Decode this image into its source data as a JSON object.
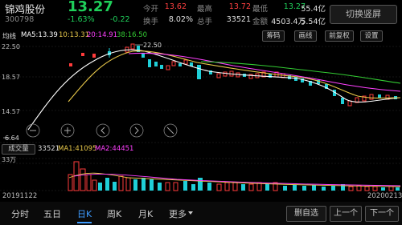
{
  "header": {
    "name": "锦鸡股份",
    "price": "13.27",
    "code": "300798",
    "change_pct": "-1.63%",
    "change_val": "-0.22",
    "quotes": [
      {
        "label": "今开",
        "value": "13.62",
        "color": "#ff4040"
      },
      {
        "label": "最高",
        "value": "13.72",
        "color": "#ff4040"
      },
      {
        "label": "最低",
        "value": "13.27",
        "color": "#1fcf5a"
      },
      {
        "label": "总值",
        "value": "55.4亿",
        "color": "#e0e0e0"
      },
      {
        "label": "换手",
        "value": "8.02%",
        "color": "#e0e0e0"
      },
      {
        "label": "总手",
        "value": "33521",
        "color": "#e0e0e0"
      },
      {
        "label": "金额",
        "value": "4503.4万",
        "color": "#e0e0e0"
      },
      {
        "label": "流值",
        "value": "5.54亿",
        "color": "#e0e0e0"
      }
    ],
    "fullscreen_btn": "切换竖屏"
  },
  "ma_bar": {
    "label": "均线",
    "ma5": "MA5:13.39",
    "ma10": "10:13.31",
    "ma20": "20:14.91",
    "ma30": "38:16.50",
    "btn_chips": "筹码",
    "btn_draw": "画线",
    "btn_adjust": "前复权",
    "btn_settings": "设置"
  },
  "price_axis": {
    "top": "22.50",
    "mid1": "18.57",
    "mid2": "14.57",
    "mid3": "10.5",
    "bottom": "6.64"
  },
  "annotations": {
    "high": "22.50",
    "low": "6.64"
  },
  "volume_bar": {
    "button": "成交量",
    "vol": "33521",
    "ma1": "MA1:41095",
    "ma2": "MA2:44451",
    "axis_top": "33万"
  },
  "dates": {
    "start": "20191122",
    "end": "20200213"
  },
  "bottom_nav": {
    "tabs": [
      "分时",
      "五日",
      "日K",
      "周K",
      "月K",
      "更多"
    ],
    "active_tab": "日K",
    "btn_watch": "删自选",
    "btn_prev": "上一个",
    "btn_next": "下一个"
  },
  "colors": {
    "up": "#ff3b3b",
    "down": "#1fcfd8",
    "ma5": "#ffffff",
    "ma10": "#e8c84a",
    "ma20": "#ff40ff",
    "ma30": "#33cc33"
  },
  "chart_data": {
    "type": "candlestick",
    "x": [
      "20191122",
      "20200213"
    ],
    "ylim": [
      6.64,
      22.5
    ],
    "series_ma": [
      {
        "name": "MA5",
        "value": 13.39
      },
      {
        "name": "MA10",
        "value": 13.31
      },
      {
        "name": "MA20",
        "value": 14.91
      },
      {
        "name": "MA30",
        "value": 16.5
      }
    ],
    "volume_latest": 33521,
    "volume_ma": [
      41095,
      44451
    ]
  }
}
